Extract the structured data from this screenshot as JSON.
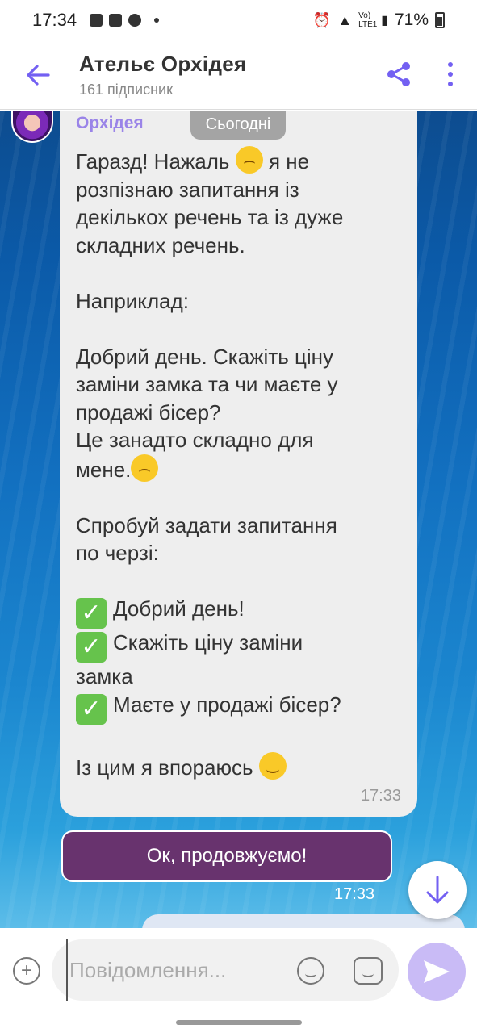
{
  "status_bar": {
    "time": "17:34",
    "battery": "71%",
    "network": "Vo) LTE1"
  },
  "header": {
    "title": "Ательє Орхідея",
    "subtitle": "161 підписник",
    "back_icon": "arrow-left-icon",
    "share_icon": "share-icon",
    "more_icon": "more-vertical-icon"
  },
  "chat": {
    "date_chip": "Сьогодні",
    "incoming": {
      "sender": "Орхідея",
      "line1_a": "Гаразд! Нажаль ",
      "line1_b": " я не\nрозпізнаю запитання із\nдекількох речень та із дуже\nскладних речень.\n\nНаприклад:\n\nДобрий день. Скажіть ціну\nзаміни замка та чи маєте у\nпродажі бісер?\nЦе занадто складно для\nмене.",
      "part2": "\n\nСпробуй задати запитання\nпо черзі:\n\n",
      "check1": "Добрий день!",
      "check2": "Скажіть ціну заміни\nзамка",
      "check3": "Маєте у продажі бісер?",
      "final": "\n\nІз цим я впораюсь ",
      "check_glyph": "✓",
      "time": "17:33"
    },
    "outgoing": {
      "text": "Ок, продовжуємо!",
      "time": "17:33"
    }
  },
  "compose": {
    "placeholder": "Повідомлення...",
    "add_icon": "plus-circle-icon",
    "sticker_icon": "smiley-icon",
    "gif_icon": "sticker-icon",
    "send_icon": "send-icon"
  },
  "colors": {
    "accent": "#7360f2",
    "outgoing_bubble": "#68336e",
    "sender_name": "#9a84e8",
    "send_button": "#c9bbf6"
  }
}
